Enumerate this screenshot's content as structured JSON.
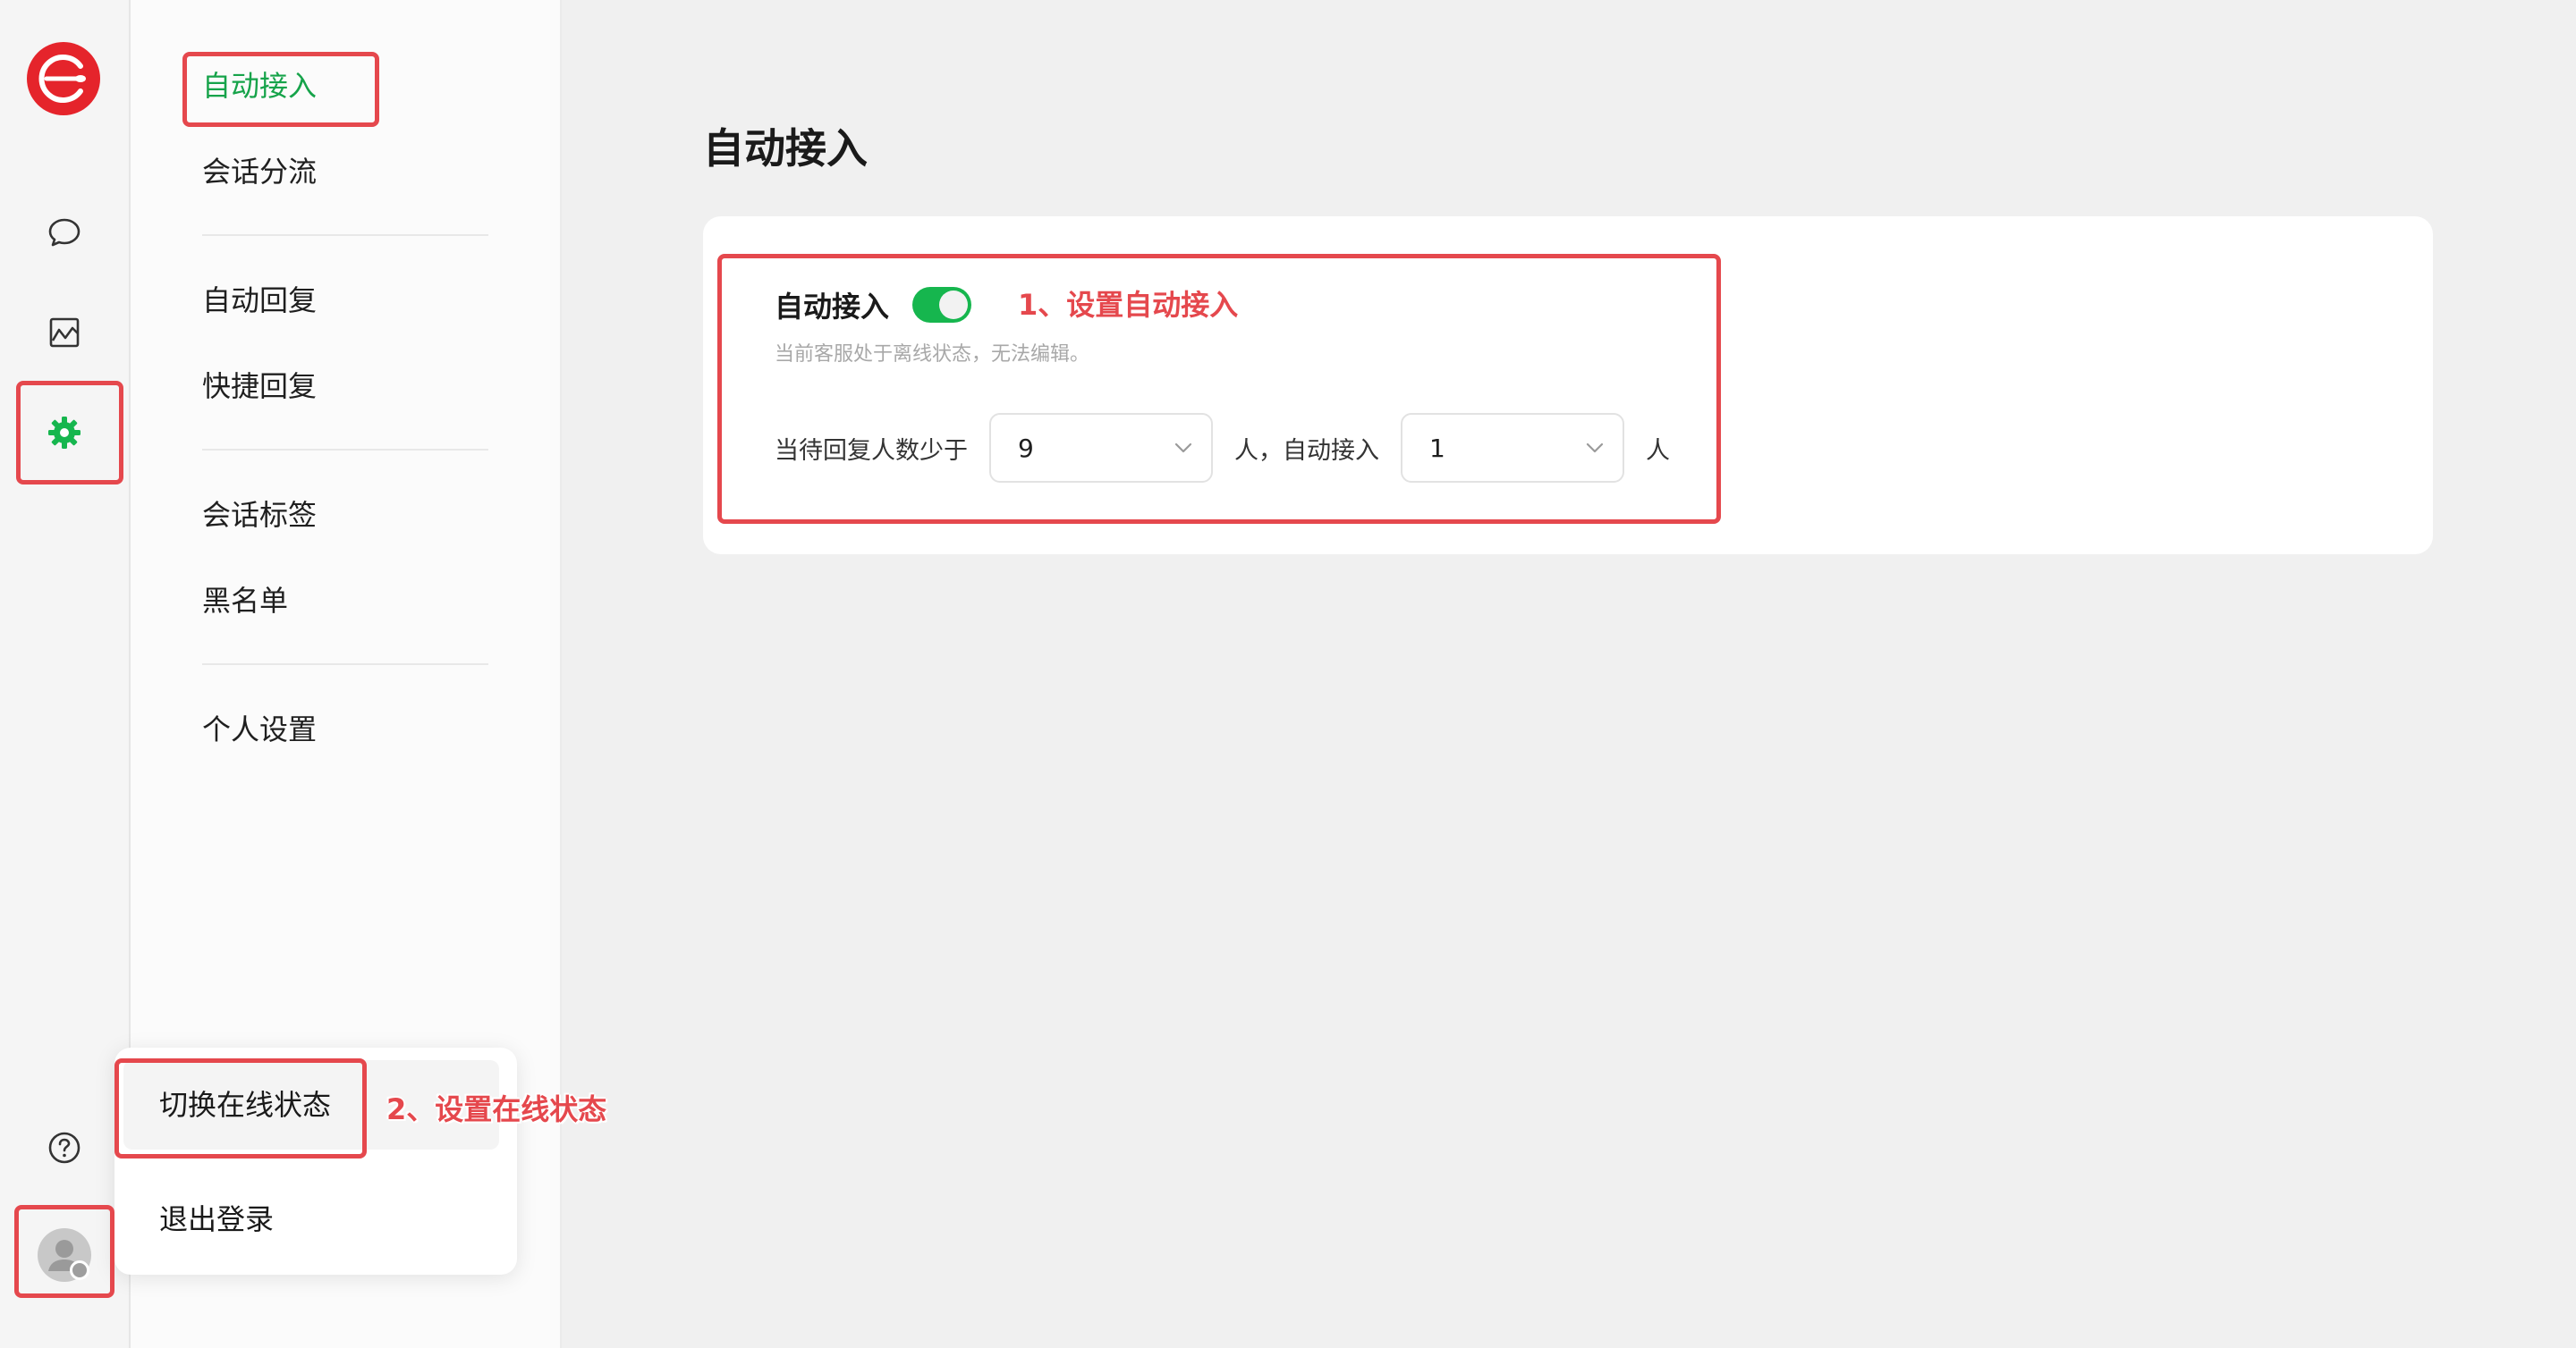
{
  "rail": {
    "icons": [
      "chat-icon",
      "analytics-icon",
      "gear-icon",
      "help-icon"
    ],
    "accent_color": "#16b64e"
  },
  "menu": {
    "items": [
      {
        "label": "自动接入"
      },
      {
        "label": "会话分流"
      },
      {
        "label": "自动回复"
      },
      {
        "label": "快捷回复"
      },
      {
        "label": "会话标签"
      },
      {
        "label": "黑名单"
      },
      {
        "label": "个人设置"
      }
    ]
  },
  "main": {
    "title": "自动接入",
    "card": {
      "toggle_label": "自动接入",
      "toggle_on": true,
      "hint": "当前客服处于离线状态，无法编辑。",
      "condition_prefix": "当待回复人数少于",
      "threshold_value": "9",
      "condition_middle": "人，自动接入",
      "accept_value": "1",
      "condition_suffix": "人"
    }
  },
  "popup": {
    "items": [
      {
        "label": "切换在线状态"
      },
      {
        "label": "退出登录"
      }
    ]
  },
  "annotations": {
    "note1": "1、设置自动接入",
    "note2": "2、设置在线状态",
    "color": "#e5484d"
  }
}
